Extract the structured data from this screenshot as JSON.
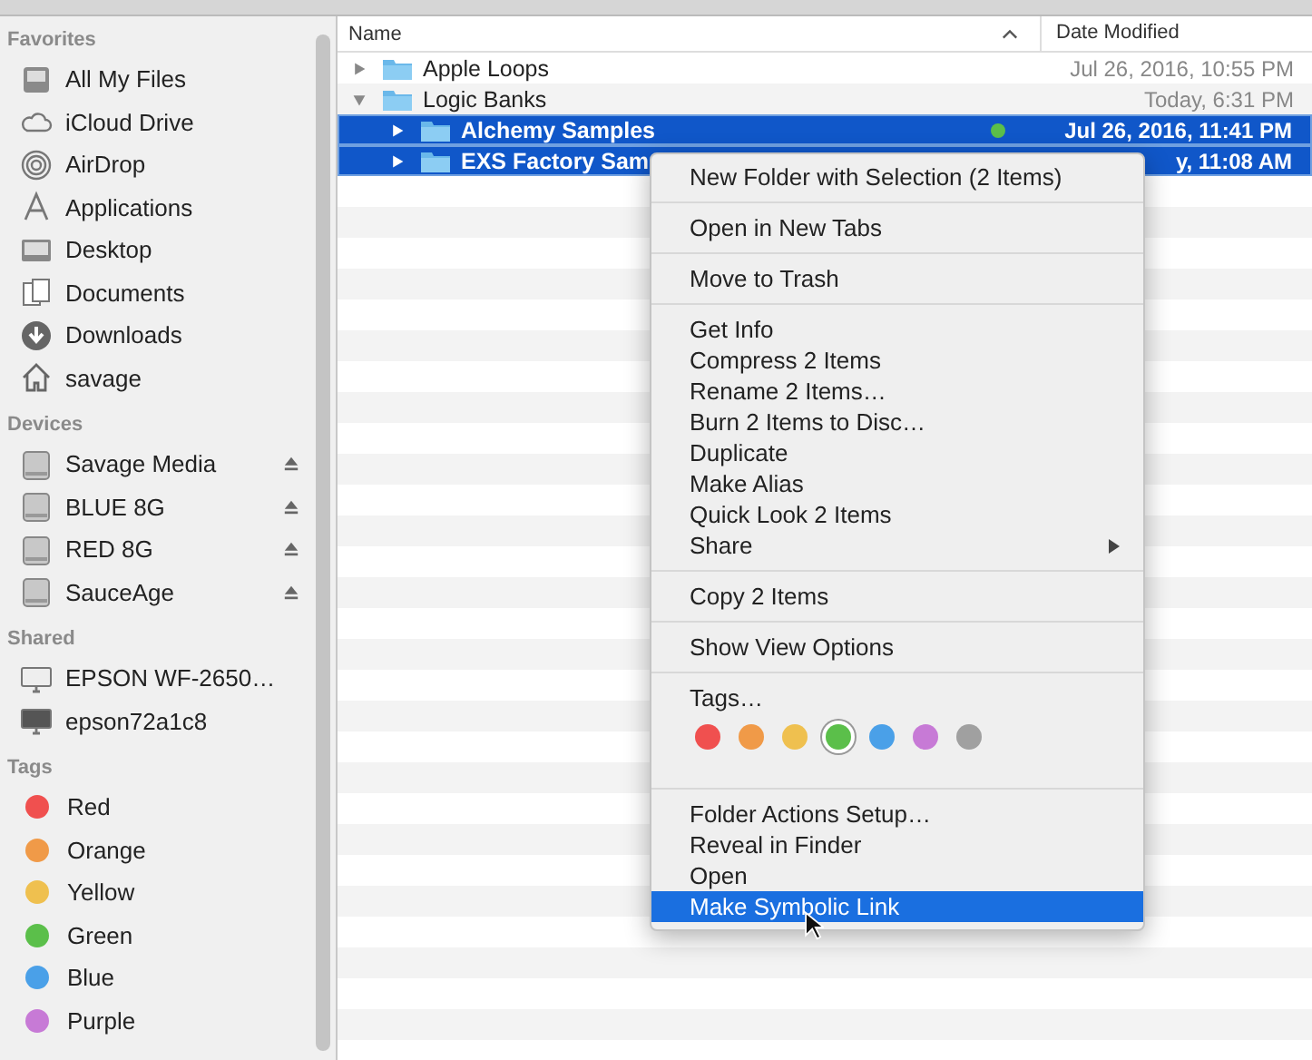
{
  "sidebar": {
    "sections": [
      {
        "heading": "Favorites",
        "items": [
          {
            "label": "All My Files"
          },
          {
            "label": "iCloud Drive"
          },
          {
            "label": "AirDrop"
          },
          {
            "label": "Applications"
          },
          {
            "label": "Desktop"
          },
          {
            "label": "Documents"
          },
          {
            "label": "Downloads"
          },
          {
            "label": "savage"
          }
        ]
      },
      {
        "heading": "Devices",
        "items": [
          {
            "label": "Savage Media",
            "eject": true
          },
          {
            "label": "BLUE 8G",
            "eject": true
          },
          {
            "label": "RED 8G",
            "eject": true
          },
          {
            "label": "SauceAge",
            "eject": true
          }
        ]
      },
      {
        "heading": "Shared",
        "items": [
          {
            "label": "EPSON WF-2650…"
          },
          {
            "label": "epson72a1c8"
          }
        ]
      },
      {
        "heading": "Tags",
        "items": [
          {
            "label": "Red",
            "color": "#f0504f"
          },
          {
            "label": "Orange",
            "color": "#f09a48"
          },
          {
            "label": "Yellow",
            "color": "#efc04f"
          },
          {
            "label": "Green",
            "color": "#5bbf4a"
          },
          {
            "label": "Blue",
            "color": "#4aa0e8"
          },
          {
            "label": "Purple",
            "color": "#c77ad6"
          }
        ]
      }
    ]
  },
  "table": {
    "columns": [
      "Name",
      "Date Modified"
    ],
    "rows": [
      {
        "name": "Apple Loops",
        "date": "Jul 26, 2016, 10:55 PM",
        "expanded": false,
        "selected": false,
        "children": []
      },
      {
        "name": "Logic Banks",
        "date": "Today, 6:31 PM",
        "expanded": true,
        "selected": false,
        "children": [
          {
            "name": "Alchemy Samples",
            "date": "Jul 26, 2016, 11:41 PM",
            "expanded": false,
            "selected": true,
            "color": "#5bbf4a"
          },
          {
            "name": "EXS Factory Sam",
            "date": "y, 11:08 AM",
            "expanded": false,
            "selected": true
          }
        ]
      }
    ]
  },
  "context_menu": {
    "items": [
      {
        "kind": "item",
        "label": "New Folder with Selection (2 Items)",
        "selected": false
      },
      {
        "kind": "separator"
      },
      {
        "kind": "item",
        "label": "Open in New Tabs",
        "selected": false
      },
      {
        "kind": "separator"
      },
      {
        "kind": "item",
        "label": "Move to Trash",
        "selected": false
      },
      {
        "kind": "separator"
      },
      {
        "kind": "item",
        "label": "Get Info",
        "selected": false
      },
      {
        "kind": "item",
        "label": "Compress 2 Items",
        "selected": false
      },
      {
        "kind": "item",
        "label": "Rename 2 Items…",
        "selected": false
      },
      {
        "kind": "item",
        "label": "Burn 2 Items to Disc…",
        "selected": false
      },
      {
        "kind": "item",
        "label": "Duplicate",
        "selected": false
      },
      {
        "kind": "item",
        "label": "Make Alias",
        "selected": false
      },
      {
        "kind": "item",
        "label": "Quick Look 2 Items",
        "selected": false
      },
      {
        "kind": "item",
        "label": "Share",
        "selected": false,
        "submenu": true
      },
      {
        "kind": "separator"
      },
      {
        "kind": "item",
        "label": "Copy 2 Items",
        "selected": false
      },
      {
        "kind": "separator"
      },
      {
        "kind": "item",
        "label": "Show View Options",
        "selected": false
      },
      {
        "kind": "separator"
      },
      {
        "kind": "item",
        "label": "Tags…",
        "selected": false
      },
      {
        "kind": "tags",
        "colors": [
          {
            "color": "#f0504f",
            "selected": false
          },
          {
            "color": "#f09a48",
            "selected": false
          },
          {
            "color": "#efc04f",
            "selected": false
          },
          {
            "color": "#5bbf4a",
            "selected": true
          },
          {
            "color": "#4aa0e8",
            "selected": false
          },
          {
            "color": "#c77ad6",
            "selected": false
          },
          {
            "color": "#a0a0a0",
            "selected": false
          }
        ]
      },
      {
        "kind": "separator"
      },
      {
        "kind": "item",
        "label": "Folder Actions Setup…",
        "selected": false
      },
      {
        "kind": "item",
        "label": "Reveal in Finder",
        "selected": false
      },
      {
        "kind": "item",
        "label": "Open",
        "selected": false
      },
      {
        "kind": "item",
        "label": "Make Symbolic Link",
        "selected": true
      }
    ]
  }
}
